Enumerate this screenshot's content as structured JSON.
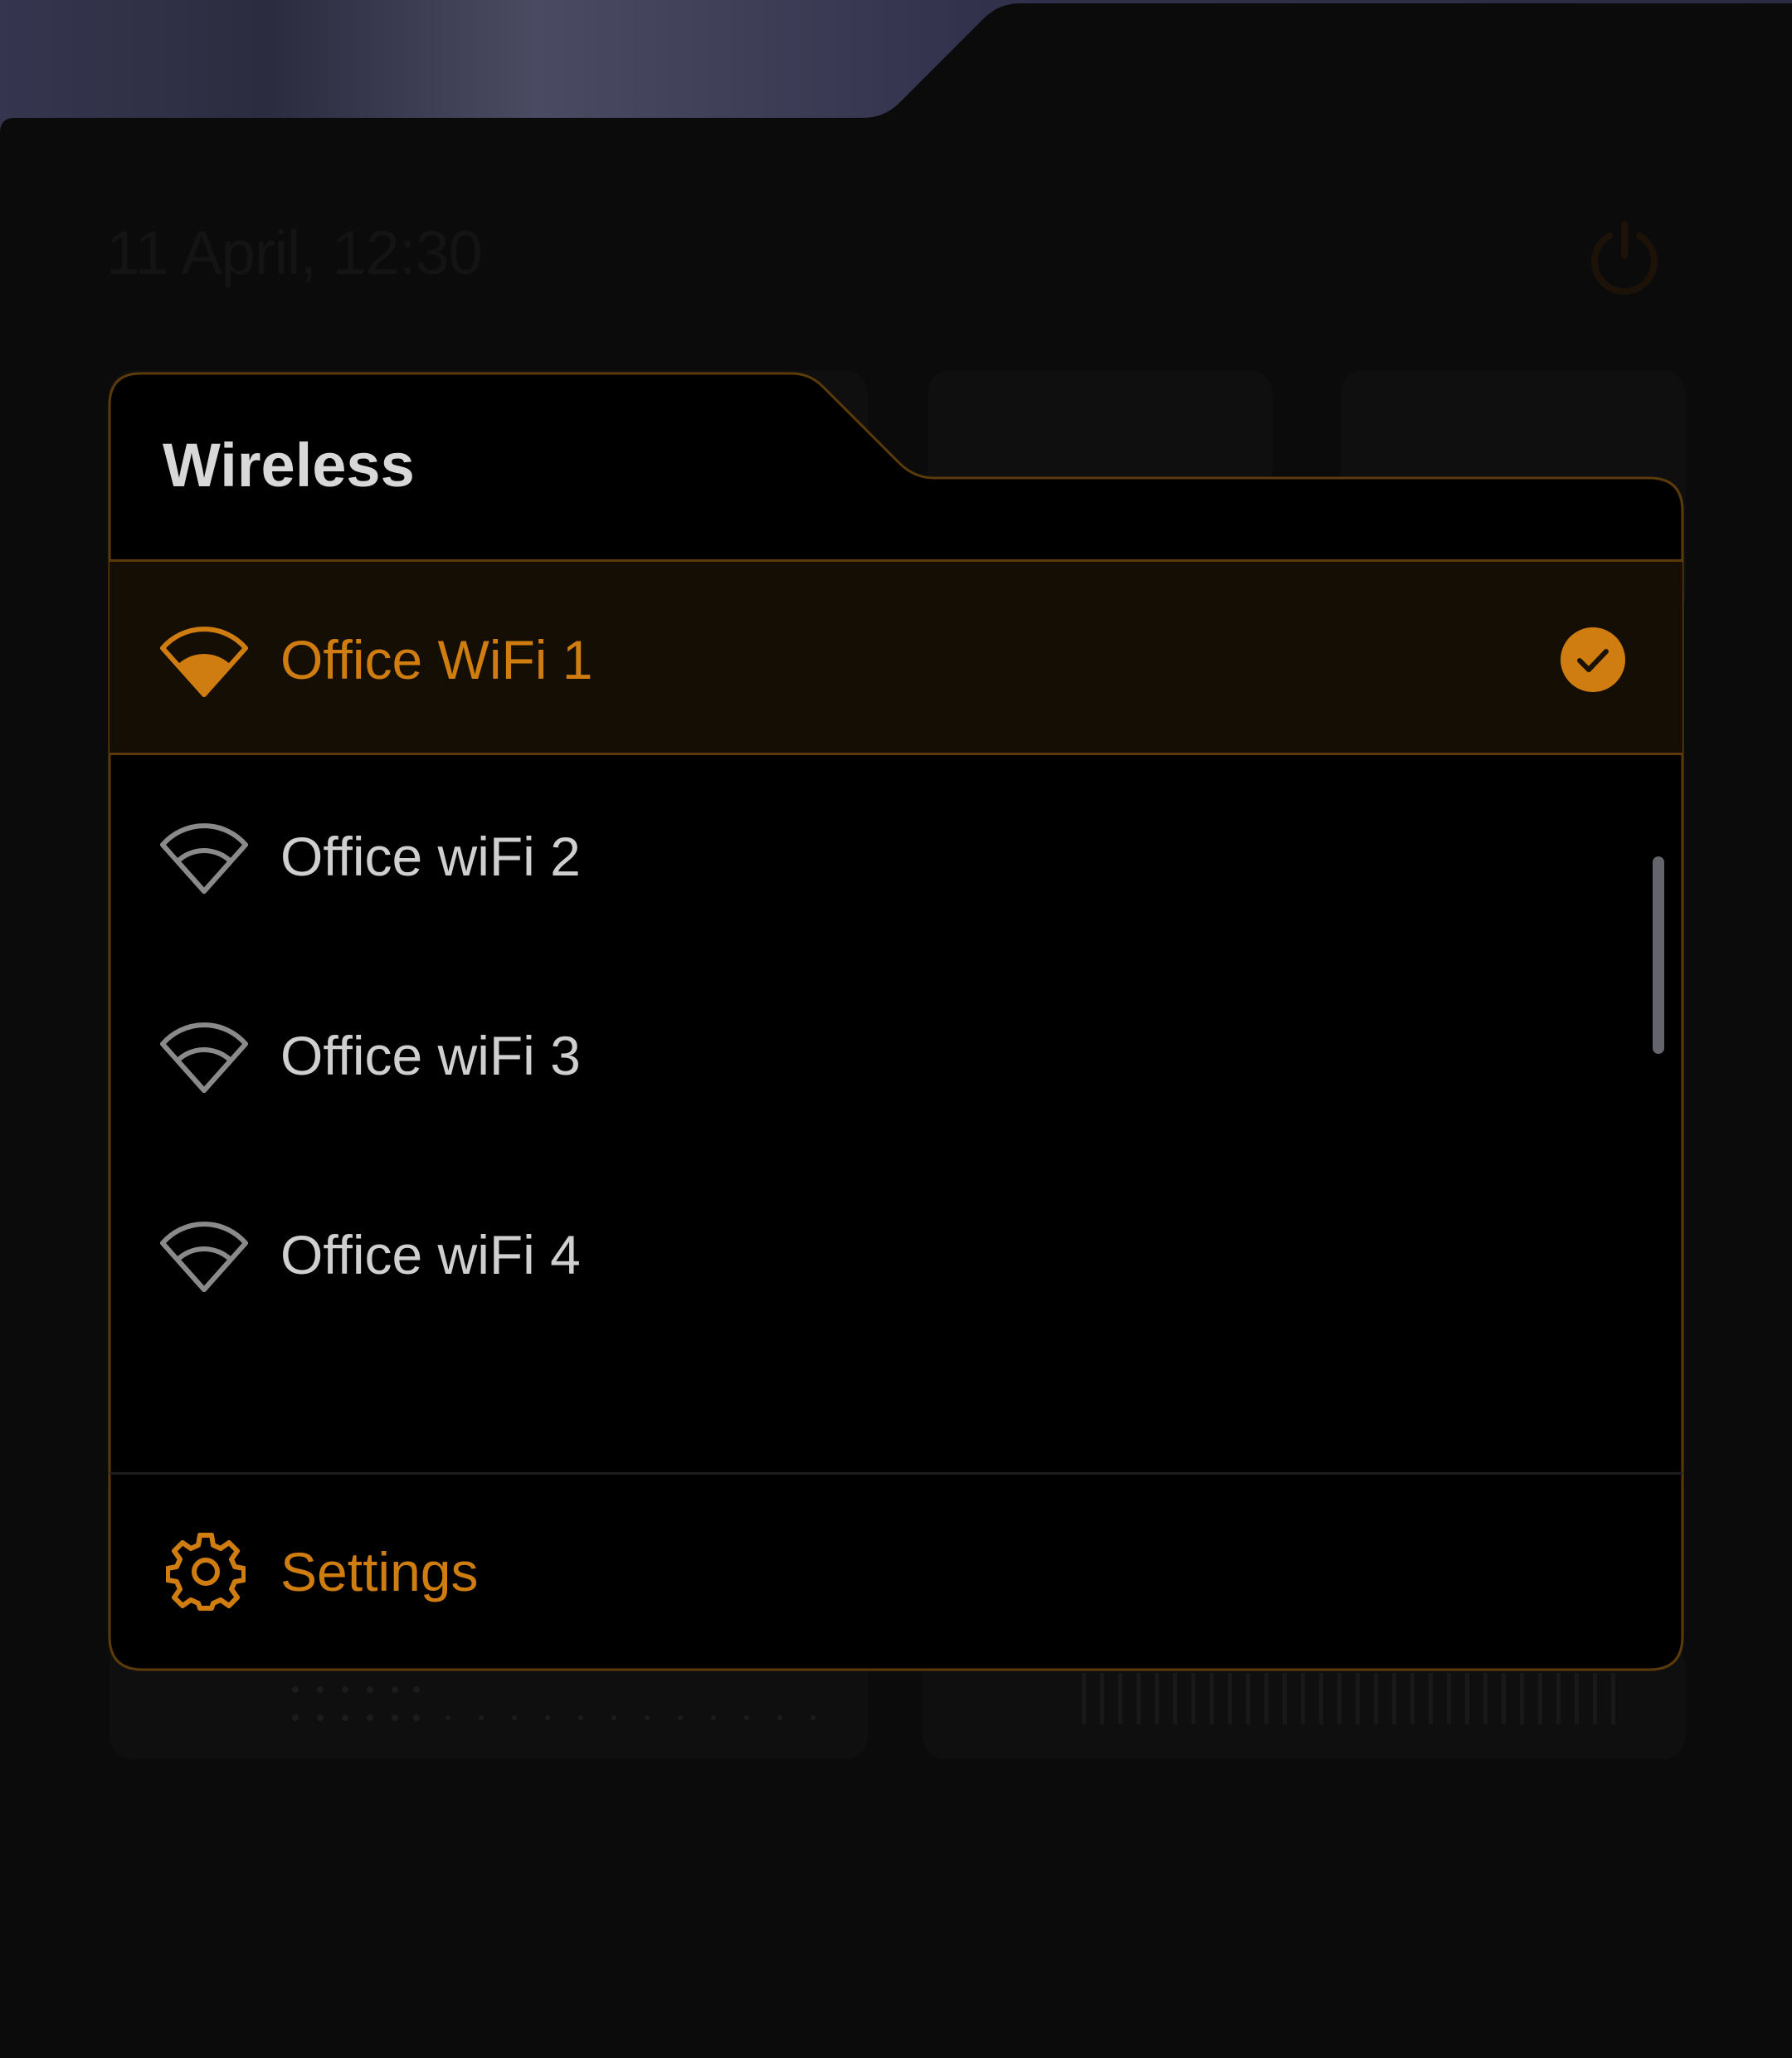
{
  "background": {
    "datetime": "11 April, 12:30"
  },
  "panel": {
    "title": "Wireless",
    "networks": [
      {
        "name": "Office WiFi 1",
        "selected": true
      },
      {
        "name": "Office wiFi 2",
        "selected": false
      },
      {
        "name": "Office wiFi 3",
        "selected": false
      },
      {
        "name": "Office wiFi 4",
        "selected": false
      }
    ],
    "settings_label": "Settings"
  },
  "colors": {
    "accent": "#cf7c10",
    "panel_border": "#5c3a0a",
    "selected_row_bg": "#150e05",
    "text_primary": "#d8d8d8",
    "icon_inactive": "#8a8a8a"
  },
  "icons": {
    "network": "wifi-icon",
    "selected": "check-circle-icon",
    "settings": "gear-icon",
    "power": "power-icon"
  }
}
